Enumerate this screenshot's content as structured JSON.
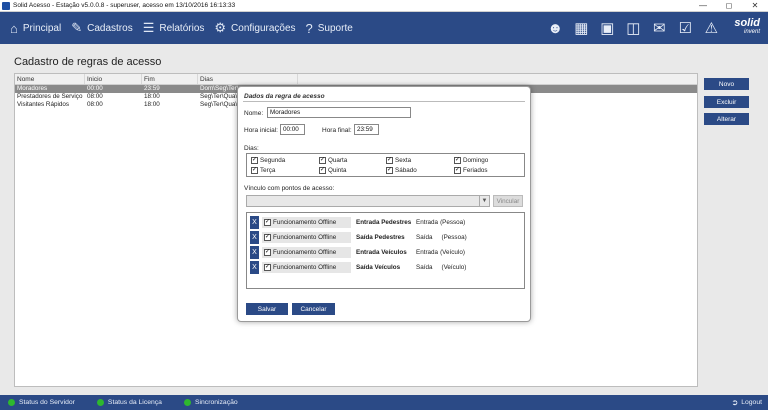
{
  "window": {
    "title": "Solid Acesso - Estação v5.0.0.8 - superuser, acesso em 13/10/2016 16:13:33",
    "minimize_icon": "minimize-icon",
    "maximize_icon": "maximize-icon",
    "close_icon": "close-icon"
  },
  "nav": {
    "items": [
      {
        "label": "Principal",
        "icon": "home-icon"
      },
      {
        "label": "Cadastros",
        "icon": "pencil-icon"
      },
      {
        "label": "Relatórios",
        "icon": "list-icon"
      },
      {
        "label": "Configurações",
        "icon": "gear-icon"
      },
      {
        "label": "Suporte",
        "icon": "question-icon"
      }
    ],
    "toolbar_icons": [
      "add-user-icon",
      "calendar-icon",
      "garage-icon",
      "board-icon",
      "mail-icon",
      "checklist-icon",
      "alert-icon"
    ],
    "logo_main": "solid",
    "logo_sub": "invent"
  },
  "main": {
    "title": "Cadastro de regras de acesso",
    "columns": [
      "Nome",
      "Inicio",
      "Fim",
      "Dias"
    ],
    "rows": [
      {
        "nome": "Moradores",
        "inicio": "00:00",
        "fim": "23:59",
        "dias": "Dom\\Seg\\Ter\\"
      },
      {
        "nome": "Prestadores de Serviço",
        "inicio": "08:00",
        "fim": "18:00",
        "dias": "Seg\\Ter\\Qua\\"
      },
      {
        "nome": "Visitantes Rápidos",
        "inicio": "08:00",
        "fim": "18:00",
        "dias": "Seg\\Ter\\Qua\\"
      }
    ],
    "buttons": {
      "novo": "Novo",
      "excluir": "Excluir",
      "alterar": "Alterar"
    }
  },
  "modal": {
    "title": "Dados da regra de acesso",
    "nome_label": "Nome:",
    "nome_value": "Moradores",
    "hora_inicial_label": "Hora inicial:",
    "hora_inicial_value": "00:00",
    "hora_final_label": "Hora final:",
    "hora_final_value": "23:59",
    "dias_label": "Dias:",
    "dias": [
      {
        "label": "Segunda",
        "checked": true
      },
      {
        "label": "Quarta",
        "checked": true
      },
      {
        "label": "Sexta",
        "checked": true
      },
      {
        "label": "Domingo",
        "checked": true
      },
      {
        "label": "Terça",
        "checked": true
      },
      {
        "label": "Quinta",
        "checked": true
      },
      {
        "label": "Sábado",
        "checked": true
      },
      {
        "label": "Feriados",
        "checked": true
      }
    ],
    "vinculo_label": "Vínculo com pontos de acesso:",
    "vincular_label": "Vincular",
    "pontos": [
      {
        "offline_label": "Funcionamento Offline",
        "name": "Entrada Pedestres",
        "dir": "Entrada",
        "kind": "(Pessoa)"
      },
      {
        "offline_label": "Funcionamento Offline",
        "name": "Saída Pedestres",
        "dir": "Saída",
        "kind": "(Pessoa)"
      },
      {
        "offline_label": "Funcionamento Offline",
        "name": "Entrada Veículos",
        "dir": "Entrada",
        "kind": "(Veículo)"
      },
      {
        "offline_label": "Funcionamento Offline",
        "name": "Saída Veículos",
        "dir": "Saída",
        "kind": "(Veículo)"
      }
    ],
    "remove_label": "X",
    "salvar_label": "Salvar",
    "cancelar_label": "Cancelar"
  },
  "statusbar": {
    "items": [
      "Status do Servidor",
      "Status da Licença",
      "Sincronização"
    ],
    "logout_label": "Logout"
  },
  "colors": {
    "primary": "#2b4a86",
    "status_ok": "#2eb82e",
    "selection": "#8a8a8a"
  }
}
